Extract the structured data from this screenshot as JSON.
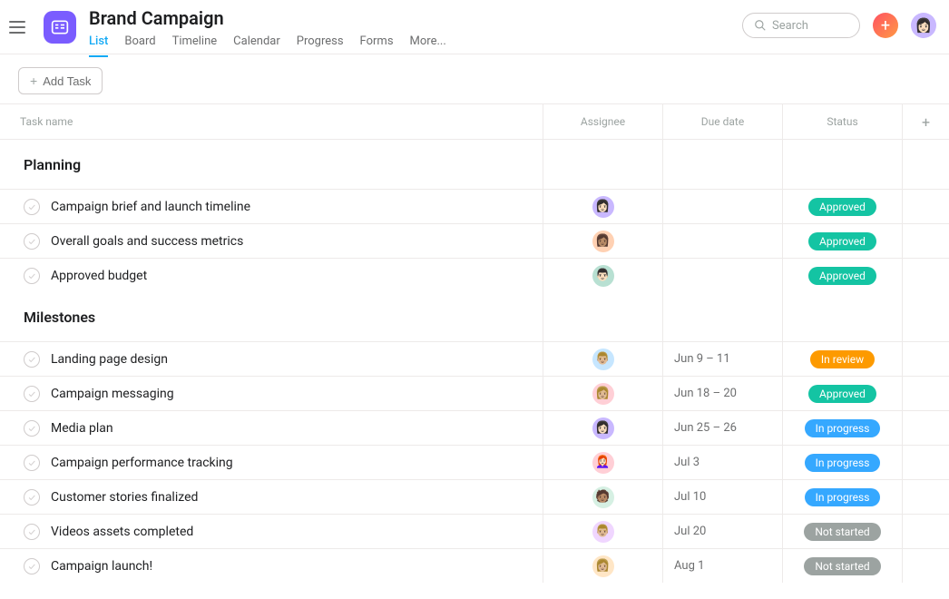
{
  "header": {
    "project_title": "Brand Campaign",
    "tabs": [
      "List",
      "Board",
      "Timeline",
      "Calendar",
      "Progress",
      "Forms",
      "More..."
    ],
    "active_tab_index": 0,
    "search_placeholder": "Search"
  },
  "toolbar": {
    "add_task_label": "Add Task"
  },
  "columns": {
    "name": "Task name",
    "assignee": "Assignee",
    "due": "Due date",
    "status": "Status"
  },
  "status_colors": {
    "Approved": "#14c4a3",
    "In review": "#fd9a00",
    "In progress": "#35a8ff",
    "Not started": "#9ca3a1"
  },
  "avatar_faces": [
    "👩🏻",
    "👨🏻",
    "👩🏽",
    "👨🏼",
    "👩🏼",
    "👩🏻‍🦰",
    "🧑🏽",
    "👩🏾"
  ],
  "sections": [
    {
      "title": "Planning",
      "tasks": [
        {
          "name": "Campaign brief and launch timeline",
          "avatar_bg": "bg-a",
          "avatar_face": 0,
          "due": "",
          "status": "Approved"
        },
        {
          "name": "Overall goals and success metrics",
          "avatar_bg": "bg-b",
          "avatar_face": 2,
          "due": "",
          "status": "Approved"
        },
        {
          "name": "Approved budget",
          "avatar_bg": "bg-c",
          "avatar_face": 1,
          "due": "",
          "status": "Approved"
        }
      ]
    },
    {
      "title": "Milestones",
      "tasks": [
        {
          "name": "Landing page design",
          "avatar_bg": "bg-d",
          "avatar_face": 3,
          "due": "Jun 9 – 11",
          "status": "In review"
        },
        {
          "name": "Campaign messaging",
          "avatar_bg": "bg-e",
          "avatar_face": 4,
          "due": "Jun 18 – 20",
          "status": "Approved"
        },
        {
          "name": "Media plan",
          "avatar_bg": "bg-a",
          "avatar_face": 0,
          "due": "Jun 25 – 26",
          "status": "In progress"
        },
        {
          "name": "Campaign performance tracking",
          "avatar_bg": "bg-e",
          "avatar_face": 5,
          "due": "Jul 3",
          "status": "In progress"
        },
        {
          "name": "Customer stories finalized",
          "avatar_bg": "bg-f",
          "avatar_face": 6,
          "due": "Jul 10",
          "status": "In progress"
        },
        {
          "name": "Videos assets completed",
          "avatar_bg": "bg-g",
          "avatar_face": 3,
          "due": "Jul 20",
          "status": "Not started"
        },
        {
          "name": "Campaign launch!",
          "avatar_bg": "bg-h",
          "avatar_face": 4,
          "due": "Aug 1",
          "status": "Not started"
        }
      ]
    }
  ]
}
